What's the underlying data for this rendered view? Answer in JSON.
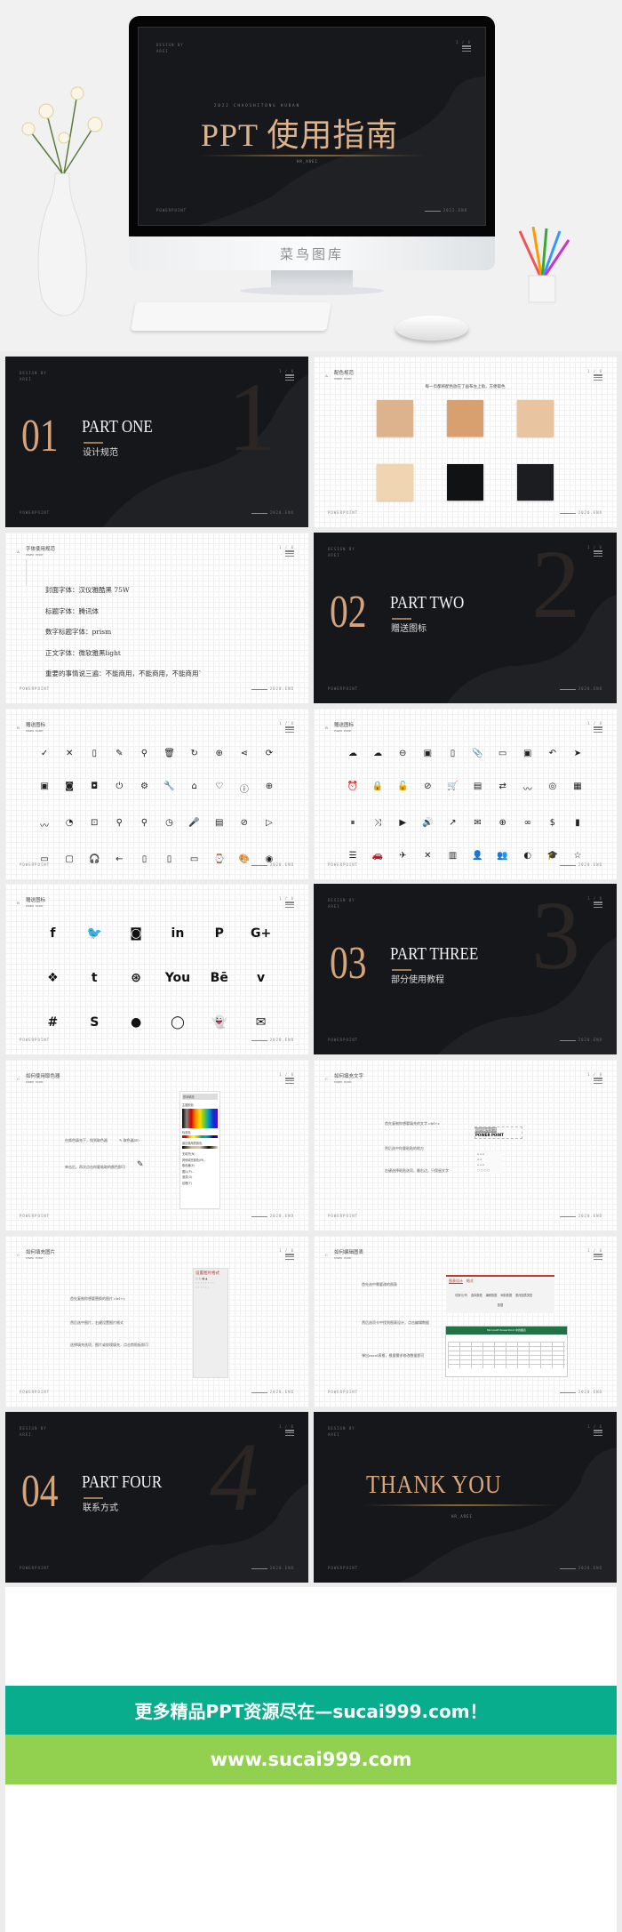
{
  "hero": {
    "overline": "2022 CHAOSHITONG HUBAN",
    "title": "PPT 使用指南",
    "author": "HR_AREI",
    "design": "DESIGN BY",
    "design_name": "AREI",
    "page": "1 / 6",
    "footer_left": "POWERPOINT",
    "footer_right": "2022.END",
    "brand": "菜鸟图库"
  },
  "common": {
    "design": "DESIGN BY",
    "design_name": "AREI",
    "page": "1 / 6",
    "footer_left": "POWERPOINT",
    "footer_right": "2020.END",
    "power_point": "POWER POINT"
  },
  "slides": {
    "part1": {
      "num": "01",
      "part": "PART ONE",
      "sub": "设计规范",
      "big": "1"
    },
    "colors": {
      "mark": "A",
      "title": "配色规范",
      "caption": "每一页都将配色放在了画布左上角，方便取色",
      "swatches": [
        "#dcb38c",
        "#d9a06f",
        "#e8c4a0",
        "#f0d5b3",
        "#111214",
        "#1c1d20"
      ]
    },
    "fonts": {
      "mark": "A",
      "title": "字体使用规范",
      "lines": [
        "封面字体：汉仪雅酷黑 75W",
        "标题字体：腾讯体",
        "数字标题字体：prism",
        "正文字体：微软雅黑light",
        "重要的事情说三遍：不能商用，不能商用，不能商用`"
      ]
    },
    "part2": {
      "num": "02",
      "part": "PART TWO",
      "sub": "赠送图标",
      "big": "2"
    },
    "icons1": {
      "mark": "B",
      "title": "赠送图标",
      "icons": [
        [
          "check",
          "✓"
        ],
        [
          "close",
          "✕"
        ],
        [
          "phone-card",
          "▯"
        ],
        [
          "pencil",
          "✎"
        ],
        [
          "search",
          "⚲"
        ],
        [
          "trash",
          "🗑"
        ],
        [
          "refresh",
          "↻"
        ],
        [
          "add-circle",
          "⊕"
        ],
        [
          "share",
          "⋖"
        ],
        [
          "sync",
          "⟳"
        ],
        [
          "gallery",
          "▣"
        ],
        [
          "camera",
          "◙"
        ],
        [
          "camera-add",
          "◘"
        ],
        [
          "power",
          "⏻"
        ],
        [
          "settings",
          "⚙"
        ],
        [
          "wrench",
          "🔧"
        ],
        [
          "home",
          "⌂"
        ],
        [
          "heart",
          "♡"
        ],
        [
          "info",
          "ⓘ"
        ],
        [
          "globe",
          "⊕"
        ],
        [
          "trend",
          "〰"
        ],
        [
          "timer",
          "◔"
        ],
        [
          "bag",
          "⊡"
        ],
        [
          "zoom-in",
          "⚲"
        ],
        [
          "zoom-out",
          "⚲"
        ],
        [
          "clock",
          "◷"
        ],
        [
          "microphone",
          "🎤"
        ],
        [
          "clapper",
          "▤"
        ],
        [
          "block",
          "⊘"
        ],
        [
          "play-circle",
          "▷"
        ],
        [
          "laptop",
          "▭"
        ],
        [
          "monitor",
          "▢"
        ],
        [
          "headphones",
          "🎧"
        ],
        [
          "arrow-left",
          "←"
        ],
        [
          "smartphone",
          "▯"
        ],
        [
          "tablet",
          "▯"
        ],
        [
          "tv",
          "▭"
        ],
        [
          "watch",
          "⌚"
        ],
        [
          "palette",
          "🎨"
        ],
        [
          "eye",
          "◉"
        ]
      ]
    },
    "icons2": {
      "mark": "B",
      "title": "赠送图标",
      "icons": [
        [
          "cloud-upload",
          "☁"
        ],
        [
          "cloud",
          "☁"
        ],
        [
          "minus-circle",
          "⊖"
        ],
        [
          "presentation",
          "▣"
        ],
        [
          "file",
          "▯"
        ],
        [
          "paperclip",
          "📎"
        ],
        [
          "folder",
          "▭"
        ],
        [
          "image",
          "▣"
        ],
        [
          "reply",
          "↶"
        ],
        [
          "send",
          "➤"
        ],
        [
          "alarm",
          "⏰"
        ],
        [
          "lock",
          "🔒"
        ],
        [
          "unlock",
          "🔓"
        ],
        [
          "ban",
          "⊘"
        ],
        [
          "cart",
          "🛒"
        ],
        [
          "store",
          "▤"
        ],
        [
          "swap",
          "⇄"
        ],
        [
          "trend",
          "〰"
        ],
        [
          "target",
          "◎"
        ],
        [
          "apps",
          "▦"
        ],
        [
          "pause-circle",
          "⏸"
        ],
        [
          "shuffle",
          "⤨"
        ],
        [
          "video",
          "▶"
        ],
        [
          "volume",
          "🔊"
        ],
        [
          "arrow-up-right",
          "↗"
        ],
        [
          "mail-box",
          "✉"
        ],
        [
          "add-circle",
          "⊕"
        ],
        [
          "link",
          "∞"
        ],
        [
          "dollar",
          "$"
        ],
        [
          "bar-chart",
          "▮"
        ],
        [
          "sliders",
          "☰"
        ],
        [
          "car",
          "🚗"
        ],
        [
          "airplane",
          "✈"
        ],
        [
          "cutlery",
          "✕"
        ],
        [
          "map",
          "▥"
        ],
        [
          "user",
          "👤"
        ],
        [
          "users",
          "👥"
        ],
        [
          "earth",
          "◐"
        ],
        [
          "graduation",
          "🎓"
        ],
        [
          "star",
          "☆"
        ]
      ]
    },
    "social": {
      "mark": "B",
      "title": "赠送图标",
      "icons": [
        [
          "facebook",
          "f"
        ],
        [
          "twitter",
          "🐦"
        ],
        [
          "instagram",
          "◙"
        ],
        [
          "linkedin",
          "in"
        ],
        [
          "pinterest",
          "P"
        ],
        [
          "google-plus",
          "G+"
        ],
        [
          "dropbox",
          "❖"
        ],
        [
          "tumblr",
          "t"
        ],
        [
          "dribbble",
          "⊛"
        ],
        [
          "youtube",
          "You"
        ],
        [
          "behance",
          "Bē"
        ],
        [
          "vimeo",
          "v"
        ],
        [
          "slack",
          "#"
        ],
        [
          "skype",
          "S"
        ],
        [
          "wechat",
          "●"
        ],
        [
          "whatsapp",
          "◯"
        ],
        [
          "snapchat",
          "👻"
        ],
        [
          "mail",
          "✉"
        ]
      ]
    },
    "part3": {
      "num": "03",
      "part": "PART THREE",
      "sub": "部分使用教程",
      "big": "3"
    },
    "picker": {
      "mark": "C",
      "title": "如何使用取色器",
      "lines": [
        "在颜色填充下，找到取色器",
        "单击后，再次点击你要吸取的颜色即可"
      ],
      "menu": [
        "形状填充",
        "主题颜色",
        "标准色",
        "最近使用的颜色",
        "无填充(N)",
        "其他填充颜色(M)...",
        "取色器(E)",
        "图片(P)...",
        "渐变(G)",
        "纹理(T)"
      ],
      "eyedropper": "取色器(E)"
    },
    "fill_text": {
      "mark": "C",
      "title": "如何填充文字",
      "lines": [
        "首先复制你想要填充的文字 ctrl+c",
        "然后选中你要粘贴的地方",
        "右键选择粘贴选项，最右边，只保留文字"
      ],
      "sample_title": "如何填充文字",
      "sample_sub": "POWER POINT"
    },
    "fill_image": {
      "mark": "C",
      "title": "如何填充图片",
      "lines": [
        "首先复制你想要替换的图片 ctrl+c",
        "然后选中图片，右键设置图片格式",
        "选择填充选项，图片或纹理填充，点击剪贴板即可"
      ],
      "panel_title": "设置图片格式"
    },
    "edit_chart": {
      "mark": "C",
      "title": "如何编辑图表",
      "lines": [
        "首先选中需要改的图表",
        "然后选项卡中找到图表设计，点击编辑数据",
        "弹出excel表格，根据需求修改数据即可"
      ],
      "ribbon_tabs": [
        "图表设计",
        "格式"
      ],
      "ribbon_group": "数据",
      "ribbon_buttons": [
        "切换行/列",
        "选择数据",
        "编辑数据",
        "刷新数据",
        "更改图表类型"
      ],
      "excel_title": "Microsoft PowerPoint 中的图表"
    },
    "part4": {
      "num": "04",
      "part": "PART FOUR",
      "sub": "联系方式",
      "big": "4"
    },
    "thanks": {
      "title": "THANK YOU",
      "author": "HR_AREI"
    }
  },
  "banners": {
    "top": "更多精品PPT资源尽在—sucai999.com！",
    "bottom": "www.sucai999.com",
    "top_color": "#07ad8c",
    "bottom_color": "#92d050"
  }
}
